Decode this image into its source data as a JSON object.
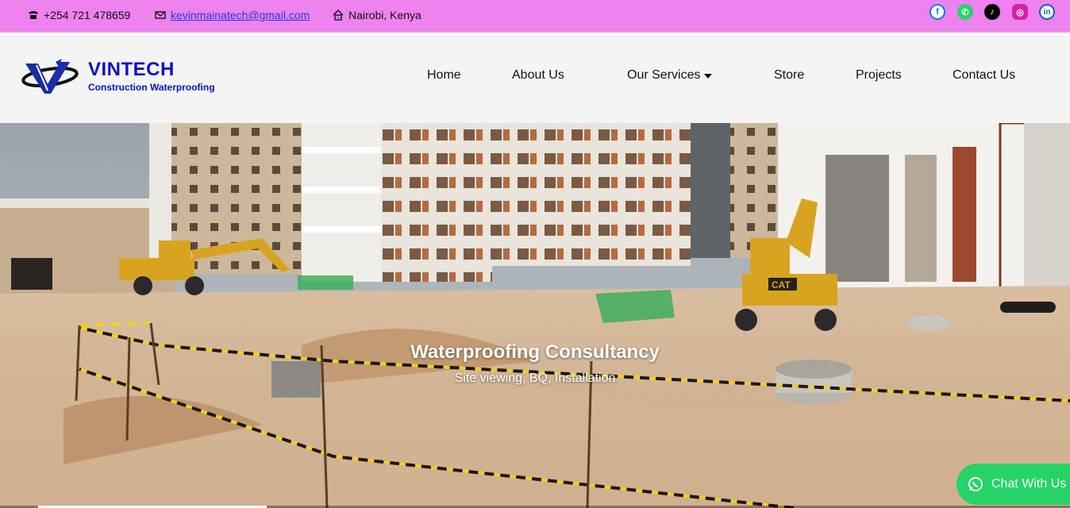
{
  "topbar": {
    "phone": "+254 721 478659",
    "email": "kevinmainatech@gmail.com",
    "location": "Nairobi, Kenya",
    "social": [
      {
        "name": "facebook",
        "glyph": "f",
        "color": "#1877f2"
      },
      {
        "name": "whatsapp",
        "glyph": "✆",
        "color": "#25d366"
      },
      {
        "name": "tiktok",
        "glyph": "♪",
        "color": "#000000"
      },
      {
        "name": "instagram",
        "glyph": "◎",
        "color": "#d6249f"
      },
      {
        "name": "linkedin",
        "glyph": "in",
        "color": "#0a66c2"
      }
    ]
  },
  "header": {
    "brand": "VINTECH",
    "tagline": "Construction Waterproofing",
    "nav": [
      "Home",
      "About Us",
      "Our Services",
      "Store",
      "Projects",
      "Contact Us"
    ]
  },
  "hero": {
    "title": "Waterproofing Consultancy",
    "subtitle": "Site viewing, BQ, Installation"
  },
  "chat": {
    "label": "Chat With Us"
  },
  "colors": {
    "topbar": "#ee82ee",
    "brand": "#1010c8",
    "chat": "#25d366"
  }
}
